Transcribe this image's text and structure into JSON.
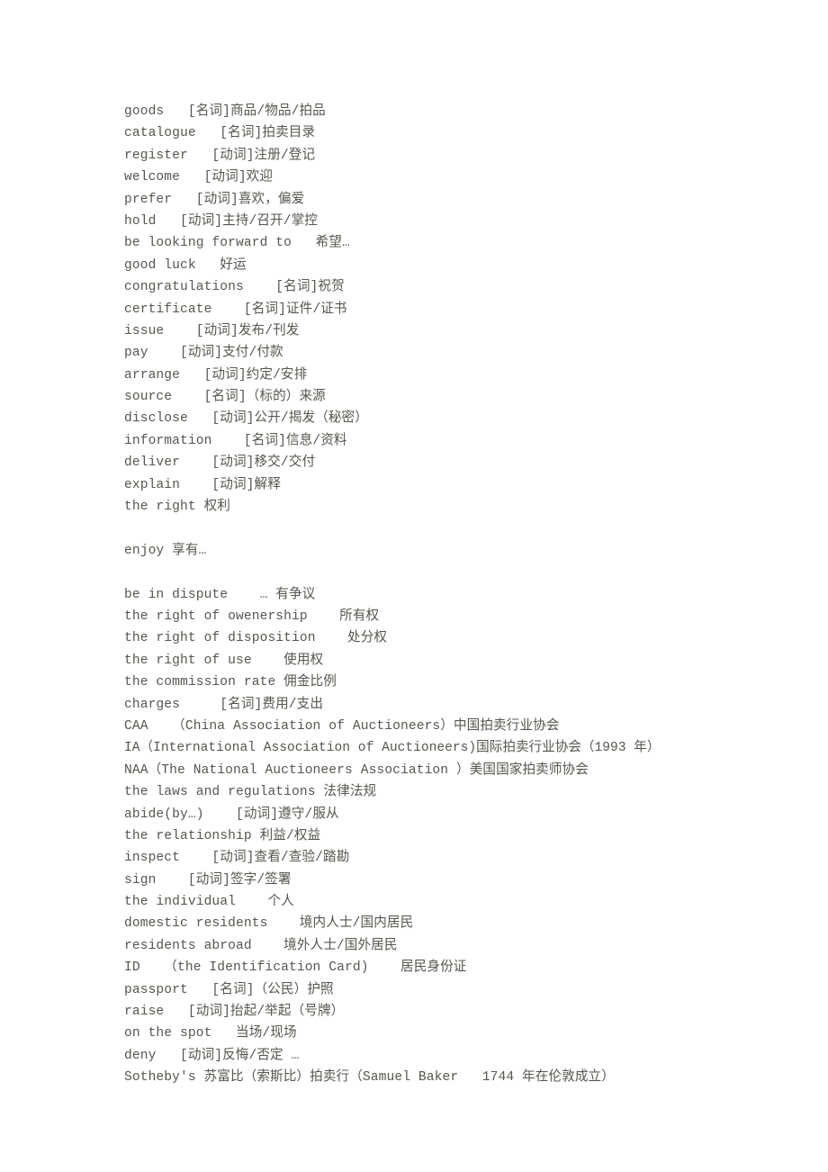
{
  "document": {
    "type": "vocabulary-glossary",
    "page_background": "#ffffff",
    "text_color": "#56564e",
    "lines": [
      "goods   [名词]商品/物品/拍品",
      "catalogue   [名词]拍卖目录",
      "register   [动词]注册/登记",
      "welcome   [动词]欢迎",
      "prefer   [动词]喜欢，偏爱",
      "hold   [动词]主持/召开/掌控",
      "be looking forward to   希望…",
      "good luck   好运",
      "congratulations    [名词]祝贺",
      "certificate    [名词]证件/证书",
      "issue    [动词]发布/刊发",
      "pay    [动词]支付/付款",
      "arrange   [动词]约定/安排",
      "source    [名词]（标的）来源",
      "disclose   [动词]公开/揭发（秘密）",
      "information    [名词]信息/资料",
      "deliver    [动词]移交/交付",
      "explain    [动词]解释",
      "the right 权利",
      "",
      "enjoy 享有…",
      "",
      "be in dispute    … 有争议",
      "the right of owenership    所有权",
      "the right of disposition    处分权",
      "the right of use    使用权",
      "the commission rate 佣金比例",
      "charges     [名词]费用/支出",
      "CAA   （China Association of Auctioneers）中国拍卖行业协会",
      "IA（International Association of Auctioneers)国际拍卖行业协会（1993 年）",
      "NAA（The National Auctioneers Association ）美国国家拍卖师协会",
      "the laws and regulations 法律法规",
      "abide(by…)    [动词]遵守/服从",
      "the relationship 利益/权益",
      "inspect    [动词]查看/查验/踏勘",
      "sign    [动词]签字/签署",
      "the individual    个人",
      "domestic residents    境内人士/国内居民",
      "residents abroad    境外人士/国外居民",
      "ID   （the Identification Card)    居民身份证",
      "passport   [名词]（公民）护照",
      "raise   [动词]抬起/举起（号牌）",
      "on the spot   当场/现场",
      "deny   [动词]反悔/否定 …",
      "Sotheby's 苏富比（索斯比）拍卖行（Samuel Baker   1744 年在伦敦成立）"
    ]
  }
}
